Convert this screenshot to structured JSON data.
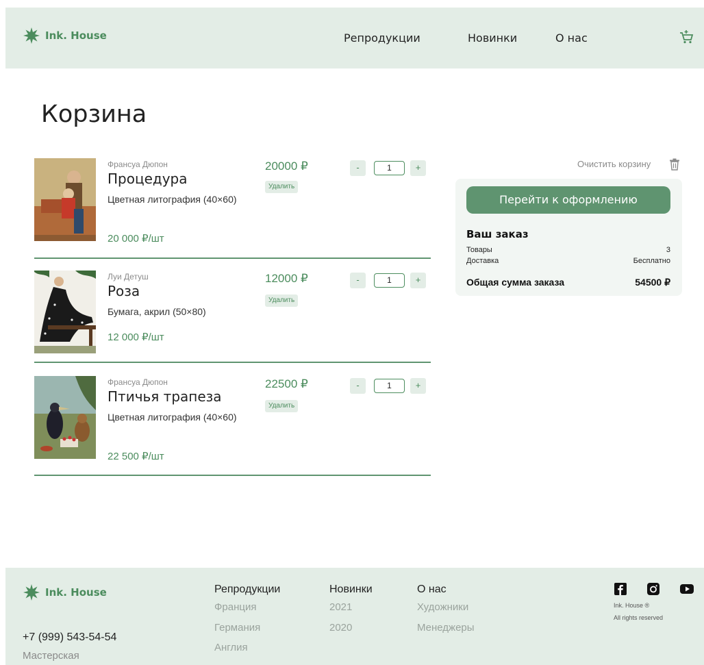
{
  "brand": {
    "name": "Ink. House",
    "accent": "#4b8c5d",
    "bg_light": "#e3ede6"
  },
  "nav": {
    "reproductions": "Репродукции",
    "new": "Новинки",
    "about": "О нас"
  },
  "page_title": "Корзина",
  "items": [
    {
      "artist": "Франсуа Дюпон",
      "name": "Процедура",
      "desc": "Цветная литография (40×60)",
      "unit_price": "20 000 ₽/шт",
      "price": "20000 ₽",
      "remove": "Удалить",
      "qty": "1"
    },
    {
      "artist": "Луи Детуш",
      "name": "Роза",
      "desc": "Бумага, акрил (50×80)",
      "unit_price": "12 000 ₽/шт",
      "price": "12000 ₽",
      "remove": "Удалить",
      "qty": "1"
    },
    {
      "artist": "Франсуа Дюпон",
      "name": "Птичья трапеза",
      "desc": "Цветная литография (40×60)",
      "unit_price": "22 500 ₽/шт",
      "price": "22500 ₽",
      "remove": "Удалить",
      "qty": "1"
    }
  ],
  "qty_minus": "-",
  "qty_plus": "+",
  "summary": {
    "clear_label": "Очистить корзину",
    "checkout_label": "Перейти к оформлению",
    "title": "Ваш заказ",
    "goods_label": "Товары",
    "goods_value": "3",
    "delivery_label": "Доставка",
    "delivery_value": "Бесплатно",
    "total_label": "Общая сумма заказа",
    "total_value": "54500 ₽"
  },
  "footer": {
    "phone": "+7 (999) 543-54-54",
    "subtitle": "Мастерская",
    "col1": {
      "title": "Репродукции",
      "links": [
        "Франция",
        "Германия",
        "Англия"
      ]
    },
    "col2": {
      "title": "Новинки",
      "links": [
        "2021",
        "2020"
      ]
    },
    "col3": {
      "title": "О нас",
      "links": [
        "Художники",
        "Менеджеры"
      ]
    },
    "copyright": "Ink. House ®",
    "rights": "All rights reserved"
  }
}
